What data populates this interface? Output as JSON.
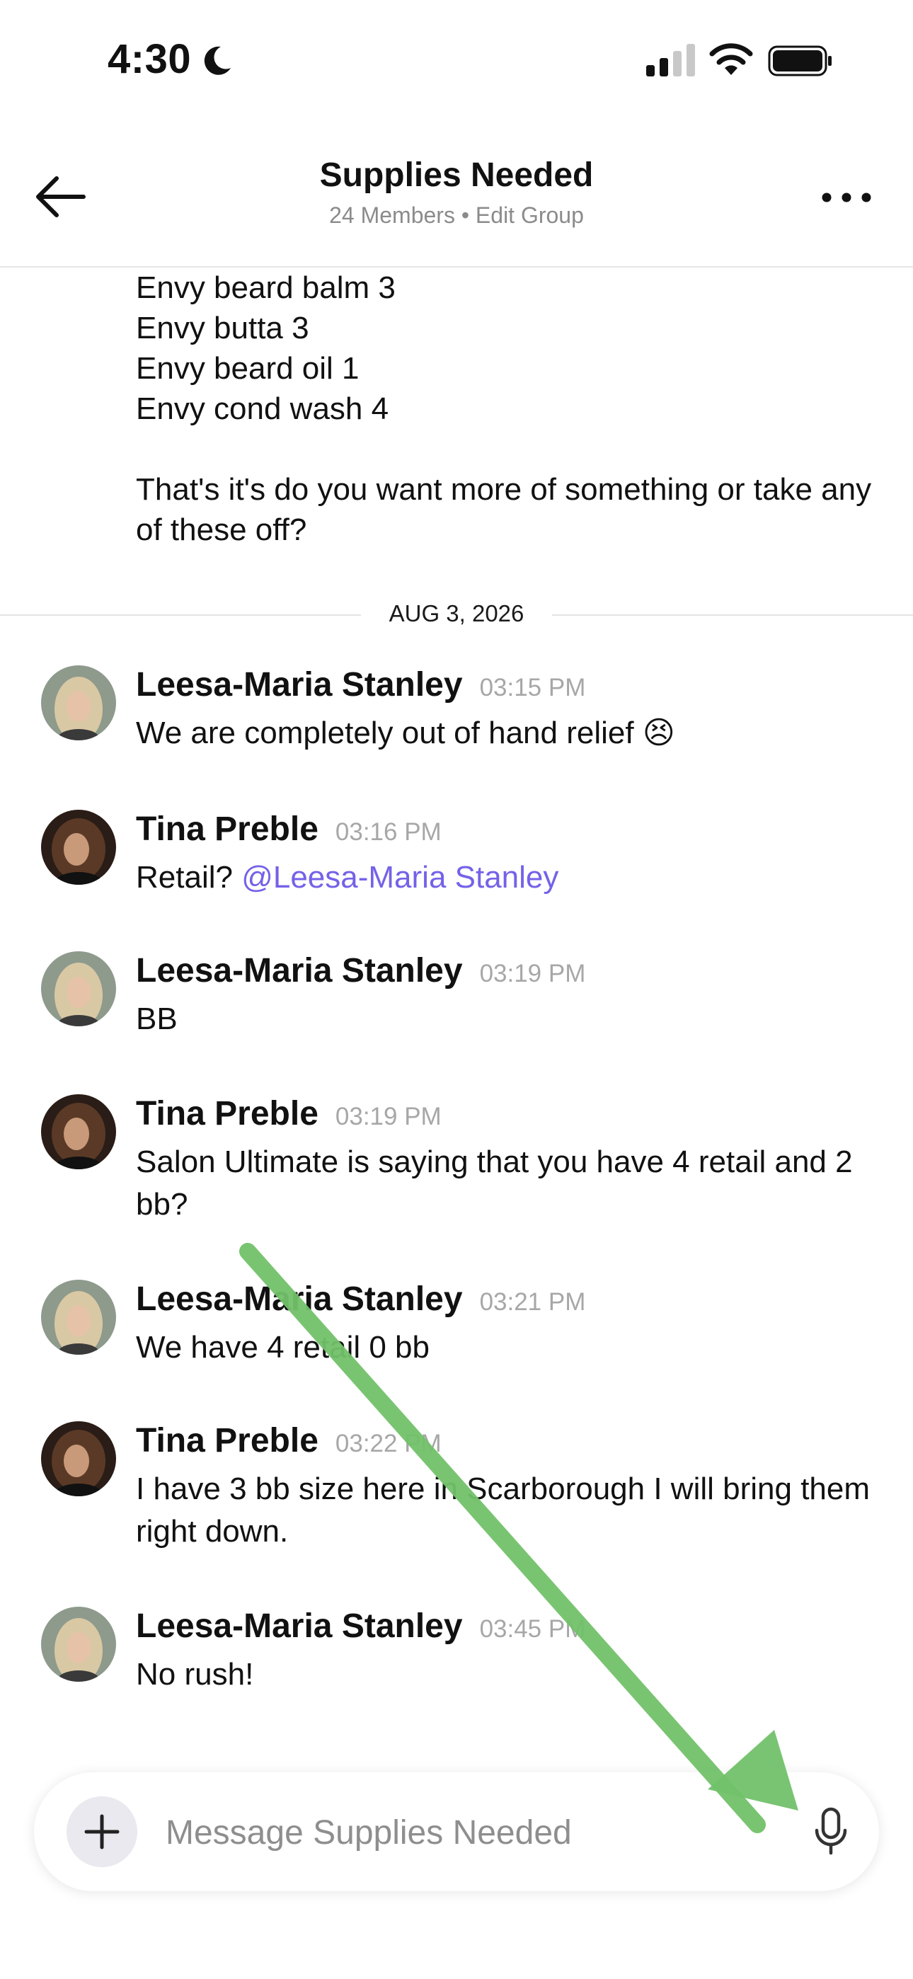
{
  "status_bar": {
    "time": "4:30"
  },
  "header": {
    "title": "Supplies Needed",
    "subtitle": "24 Members • Edit Group"
  },
  "previous_message_text": "Envy beard balm 3\nEnvy butta 3\nEnvy beard oil 1\nEnvy cond wash 4\n\nThat's it's do you want more of something or take any of these off?",
  "date_separator": "AUG 3, 2026",
  "messages": [
    {
      "sender": "Leesa-Maria Stanley",
      "time": "03:15 PM",
      "text": "We are completely out of hand relief",
      "emoji": "😣"
    },
    {
      "sender": "Tina Preble",
      "time": "03:16 PM",
      "text": "Retail? ",
      "mention": "@Leesa-Maria Stanley"
    },
    {
      "sender": "Leesa-Maria Stanley",
      "time": "03:19 PM",
      "text": "BB"
    },
    {
      "sender": "Tina Preble",
      "time": "03:19 PM",
      "text": "Salon Ultimate is saying that you have 4 retail and 2 bb?"
    },
    {
      "sender": "Leesa-Maria Stanley",
      "time": "03:21 PM",
      "text": "We have 4 retail 0 bb"
    },
    {
      "sender": "Tina Preble",
      "time": "03:22 PM",
      "text": "I have 3 bb size here in Scarborough I will bring them right down."
    },
    {
      "sender": "Leesa-Maria Stanley",
      "time": "03:45 PM",
      "text": "No rush!"
    }
  ],
  "composer": {
    "placeholder": "Message Supplies Needed"
  },
  "colors": {
    "mention": "#7462e8",
    "arrow": "#72c16a",
    "time": "#a7a7a7"
  },
  "icons": [
    "moon-icon",
    "signal-icon",
    "wifi-icon",
    "battery-icon",
    "back-arrow-icon",
    "more-icon",
    "plus-icon",
    "microphone-icon"
  ]
}
